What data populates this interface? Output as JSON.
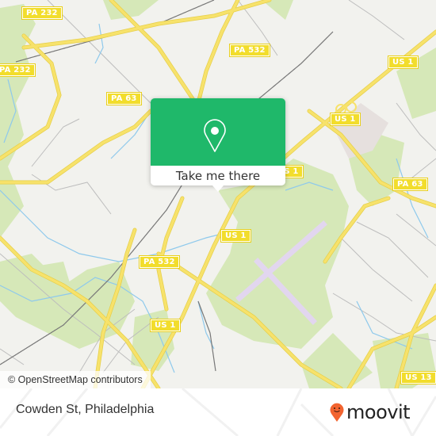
{
  "map": {
    "attribution": "© OpenStreetMap contributors",
    "colors": {
      "background": "#f2f2ee",
      "park": "#d6e8b8",
      "road_major": "#f7e26b",
      "road_casing": "#e6cf4a",
      "road_minor": "#b9b9b9",
      "water": "#8ec9ec",
      "runway": "#e2d6ef",
      "rail": "#777777",
      "commercial": "#e6e0de",
      "shield": "#f2dd2c"
    },
    "shields": [
      {
        "label": "PA 232"
      },
      {
        "label": "PA 232"
      },
      {
        "label": "PA 532"
      },
      {
        "label": "PA 63"
      },
      {
        "label": "US 1"
      },
      {
        "label": "US 1"
      },
      {
        "label": "US 1"
      },
      {
        "label": "US 1"
      },
      {
        "label": "PA 63"
      },
      {
        "label": "PA 532"
      },
      {
        "label": "US 1"
      },
      {
        "label": "US 13"
      }
    ]
  },
  "popup": {
    "icon": "map-pin-icon",
    "action_label": "Take me there",
    "color": "#1fb86a"
  },
  "footer": {
    "place_name": "Cowden St, Philadelphia",
    "logo_text": "moovit",
    "logo_icon": "moovit-pin-icon",
    "logo_color": "#f26430"
  }
}
